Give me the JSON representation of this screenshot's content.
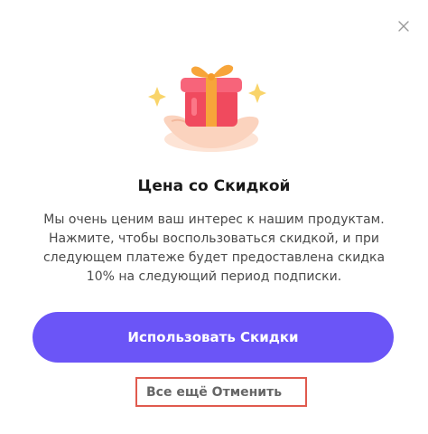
{
  "dialog": {
    "title": "Цена со Скидкой",
    "description": "Мы очень ценим ваш интерес к нашим продуктам. Нажмите, чтобы воспользоваться скидкой, и при следующем платеже будет предоставлена скидка 10% на следующий период подписки.",
    "primary_button": "Использовать Скидки",
    "secondary_button": "Все ещё Отменить",
    "close_icon": "close-icon",
    "hero_icon": "gift-in-hand-icon"
  },
  "colors": {
    "primary": "#6b55f7",
    "gift": "#f04a5e",
    "ribbon": "#f7a53a",
    "highlight_border": "#e05a4e"
  }
}
